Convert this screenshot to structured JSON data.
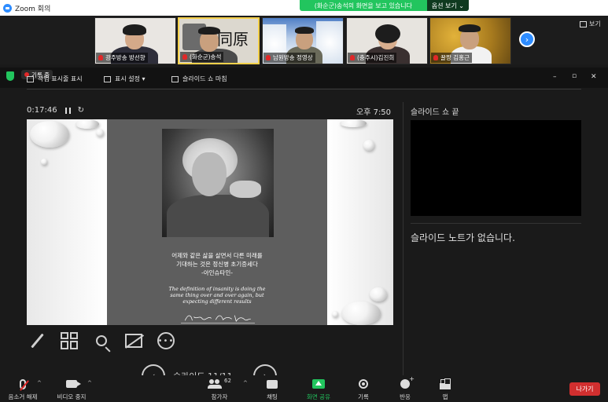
{
  "window": {
    "title": "Zoom 회의"
  },
  "share_banner": {
    "message": "(화순군)송석의 화면을 보고 있습니다",
    "options_label": "옵션 보기",
    "options_caret": "⌄"
  },
  "gallery": {
    "participants": [
      {
        "name": "광주방송 방선향"
      },
      {
        "name": "(화순군)송석"
      },
      {
        "name": "남원방송 정영상"
      },
      {
        "name": "(충주시)김진희"
      },
      {
        "name": "꿀짱 김홍근"
      }
    ],
    "tile_background_text": "同原",
    "next_icon": "›",
    "view_label": "보기"
  },
  "share_toolbar": {
    "record_label": "기록 중",
    "taskbar_label": "작업 표시줄 표시",
    "display_settings_label": "표시 설정 ▾",
    "end_slideshow_label": "슬라이드 쇼 마침",
    "minimize": "–",
    "restore": "▫",
    "close": "✕"
  },
  "presenter": {
    "elapsed": "0:17:46",
    "reset_icon": "↻",
    "clock": "오후 7:50",
    "slide_nav_label": "슬라이드 11/11",
    "prev_icon": "‹",
    "next_icon": "›",
    "more_icon": "•••",
    "next_slide_title": "슬라이드 쇼 끝",
    "notes_placeholder": "슬라이드 노트가 없습니다."
  },
  "slide": {
    "korean_lines": [
      "어제와 같은 삶을 살면서 다른 미래를",
      "기대하는 것은 정신병 초기증세다",
      "-아인슈타인-"
    ],
    "english_lines": [
      "The definition of insanity is doing the",
      "same thing over and over again, but",
      "expecting different results"
    ],
    "signature_text": "Albert Einstein"
  },
  "bottom_bar": {
    "mute_label": "음소거 해제",
    "video_label": "비디오 중지",
    "participants_label": "참가자",
    "participants_count": "62",
    "chat_label": "채팅",
    "share_label": "화면 공유",
    "record_label": "기록",
    "reactions_label": "반응",
    "apps_label": "앱",
    "end_label": "나가기",
    "caret": "^"
  },
  "colors": {
    "accent_blue": "#2d8cff",
    "share_green": "#22c55e",
    "end_red": "#d12f2f",
    "active_border": "#f5d14b"
  }
}
